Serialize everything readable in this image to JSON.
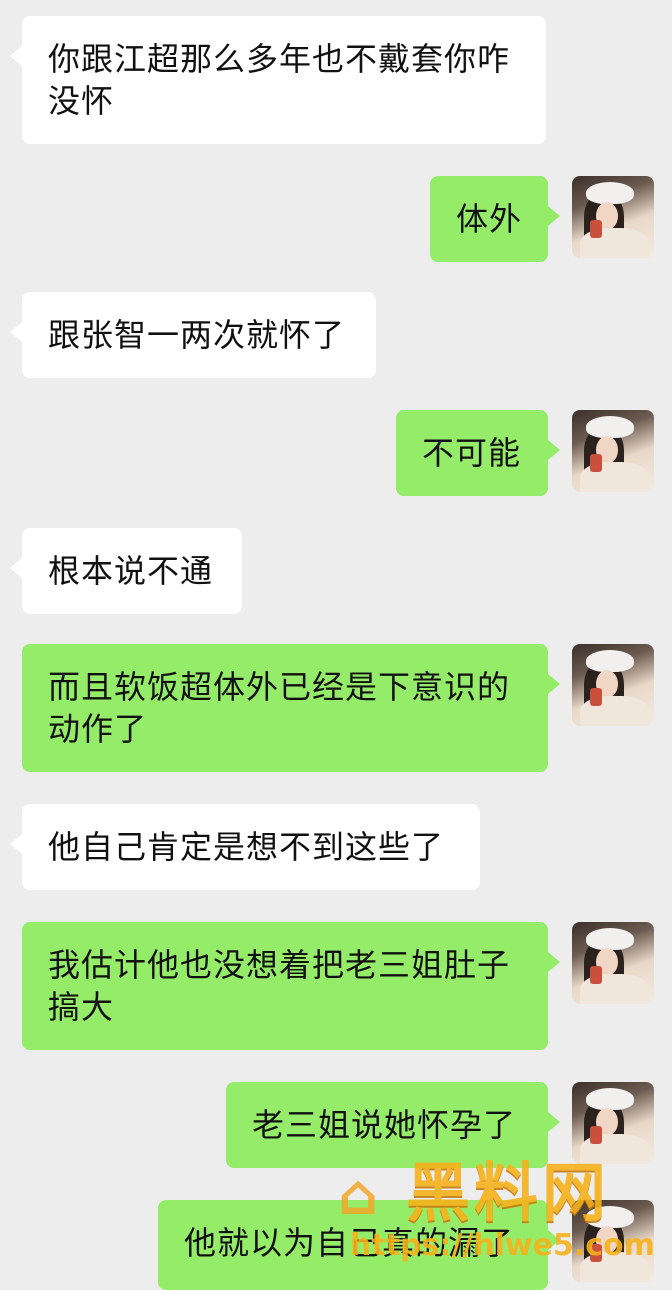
{
  "messages": [
    {
      "side": "left",
      "text": "你跟江超那么多年也不戴套你咋没怀"
    },
    {
      "side": "right",
      "text": "体外"
    },
    {
      "side": "left",
      "text": "跟张智一两次就怀了"
    },
    {
      "side": "right",
      "text": "不可能"
    },
    {
      "side": "left",
      "text": "根本说不通"
    },
    {
      "side": "right",
      "text": "而且软饭超体外已经是下意识的动作了"
    },
    {
      "side": "left",
      "text": "他自己肯定是想不到这些了"
    },
    {
      "side": "right",
      "text": "我估计他也没想着把老三姐肚子搞大"
    },
    {
      "side": "right",
      "text": "老三姐说她怀孕了"
    },
    {
      "side": "right",
      "text": "他就以为自己真的漏了"
    }
  ],
  "watermark": {
    "title": "黑料网",
    "url": "https://hlwe5.com",
    "colors": {
      "accent": "#f6b21c"
    }
  },
  "colors": {
    "background": "#ededed",
    "bubble_left": "#ffffff",
    "bubble_right": "#95ec69"
  }
}
